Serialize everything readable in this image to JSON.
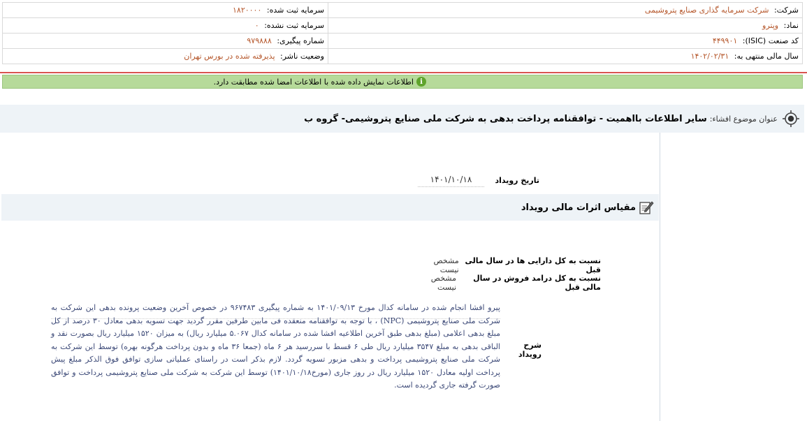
{
  "company_info": {
    "company_label": "شرکت:",
    "company_value": "شرکت سرمایه گذاری صنایع پتروشیمی",
    "registered_capital_label": "سرمایه ثبت شده:",
    "registered_capital_value": "۱۸۲۰۰۰۰",
    "symbol_label": "نماد:",
    "symbol_value": "وپترو",
    "unregistered_capital_label": "سرمایه ثبت نشده:",
    "unregistered_capital_value": "۰",
    "isic_label": "کد صنعت (ISIC):",
    "isic_value": "۴۴۹۹۰۱",
    "tracking_label": "شماره پیگیری:",
    "tracking_value": "۹۷۹۸۸۸",
    "fiscal_year_label": "سال مالی منتهی به:",
    "fiscal_year_value": "۱۴۰۲/۰۲/۳۱",
    "publisher_status_label": "وضعیت ناشر:",
    "publisher_status_value": "پذیرفته شده در بورس تهران"
  },
  "notice": {
    "text": "اطلاعات نمایش داده شده با اطلاعات امضا شده مطابقت دارد."
  },
  "subject": {
    "label": "عنوان موضوع افشاء:",
    "title": "سایر اطلاعات بااهمیت - توافقنامه پرداخت بدهی به شرکت ملی صنایع پتروشیمی- گروه ب"
  },
  "event": {
    "date_label": "تاریخ رویداد",
    "date_value": "۱۴۰۱/۱۰/۱۸"
  },
  "financial_effects": {
    "title": "مقیاس اثرات مالی رویداد",
    "rows": [
      {
        "label": "نسبت به کل دارایی ها در سال مالی قبل",
        "value": "مشخص نیست"
      },
      {
        "label": "نسبت به کل درامد فروش در سال مالی قبل",
        "value": "مشخص نیست"
      }
    ]
  },
  "description": {
    "label": "شرح رویداد",
    "text": "پیرو افشا انجام شده در سامانه کدال مورخ ۱۴۰۱/۰۹/۱۳ به شماره پیگیری ۹۶۷۴۸۳ در خصوص آخرین وضعیت پرونده بدهی این شرکت به شرکت ملی صنایع پتروشیمی (NPC) ، با توجه به توافقنامه منعقده فی مابین طرفین مقرر گردید جهت تسویه بدهی معادل ۳۰ درصد از کل مبلغ بدهی اعلامی (مبلغ بدهی طبق آخرین اطلاعیه افشا شده در سامانه کدال ۵.۰۶۷ میلیارد ریال) به میزان ۱۵۲۰ میلیارد ریال بصورت نقد و الباقی بدهی به مبلغ ۳۵۴۷ میلیارد ریال طی ۶ قسط با سررسید هر ۶ ماه (جمعا ۳۶ ماه و بدون پرداخت هرگونه بهره) توسط این شرکت به شرکت ملی صنایع پتروشیمی پرداخت و بدهی مزبور تسویه گردد. لازم بذکر است در راستای عملیاتی سازی توافق فوق الذکر مبلغ پیش پرداخت اولیه معادل ۱۵۲۰ میلیارد ریال در روز جاری (مورخ۱۴۰۱/۱۰/۱۸) توسط این شرکت به شرکت ملی صنایع پتروشیمی پرداخت و توافق صورت گرفته جاری گردیده است."
  }
}
